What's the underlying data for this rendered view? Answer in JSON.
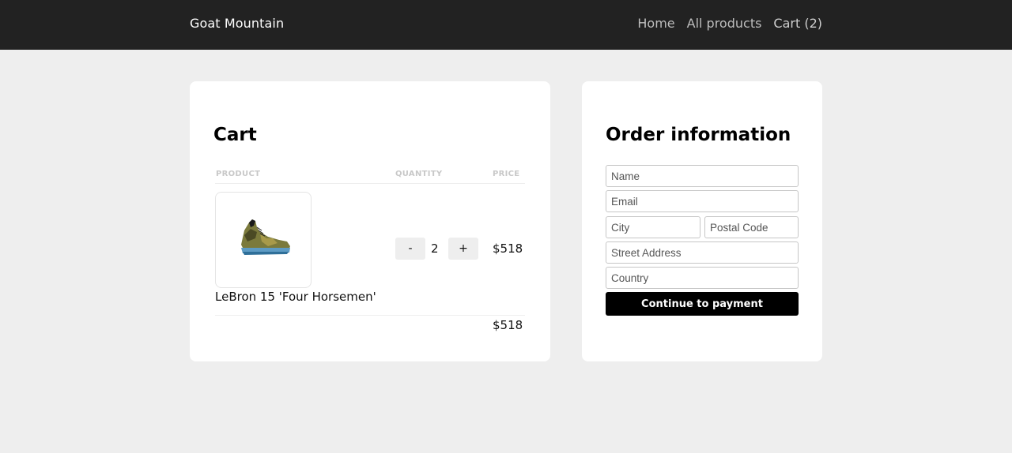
{
  "nav": {
    "brand": "Goat Mountain",
    "links": [
      "Home",
      "All products",
      "Cart (2)"
    ]
  },
  "cart": {
    "title": "Cart",
    "columns": {
      "product": "PRODUCT",
      "quantity": "QUANTITY",
      "price": "PRICE"
    },
    "items": [
      {
        "name": "LeBron 15 'Four Horsemen'",
        "quantity": "2",
        "price": "$518",
        "decrement": "-",
        "increment": "+",
        "image": "sneaker-image"
      }
    ],
    "total": "$518"
  },
  "order": {
    "title": "Order information",
    "fields": {
      "name": "Name",
      "email": "Email",
      "city": "City",
      "postal": "Postal Code",
      "street": "Street Address",
      "country": "Country"
    },
    "submit": "Continue to payment"
  },
  "colors": {
    "nav_bg": "#222222",
    "page_bg": "#eeeeee",
    "button_bg": "#000000"
  }
}
